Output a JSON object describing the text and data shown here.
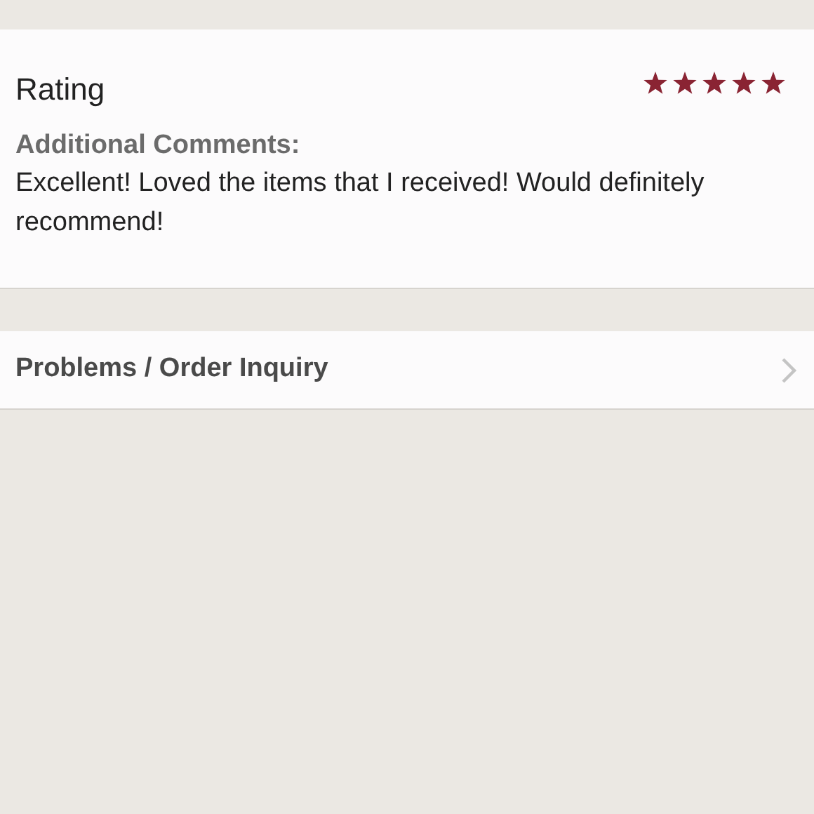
{
  "rating": {
    "label": "Rating",
    "stars": 5
  },
  "comments": {
    "label": "Additional Comments:",
    "text": "Excellent! Loved the items that I received! Would definitely recommend!"
  },
  "inquiry": {
    "label": "Problems / Order Inquiry"
  }
}
